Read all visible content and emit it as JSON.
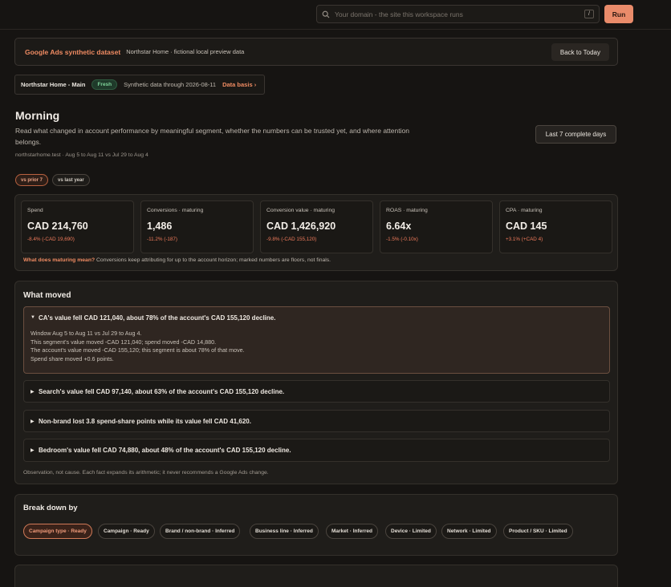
{
  "topbar": {
    "search_placeholder": "Your domain - the site this workspace runs",
    "shortcut": "/",
    "run_label": "Run"
  },
  "banner": {
    "title": "Google Ads synthetic dataset",
    "subtitle": "Northstar Home · fictional local preview data",
    "back_label": "Back to Today"
  },
  "account": {
    "name": "Northstar Home - Main",
    "badge": "Fresh",
    "through": "Synthetic data through 2026-08-11",
    "basis_link": "Data basis ›"
  },
  "heading": {
    "title": "Morning",
    "description": "Read what changed in account performance by meaningful segment, whether the numbers can be trusted yet, and where attention belongs.",
    "meta": "northstarhome.test · Aug 5 to Aug 11 vs Jul 29 to Aug 4",
    "range_label": "Last 7 complete days"
  },
  "comparisons": [
    {
      "label": "vs prior 7",
      "active": true
    },
    {
      "label": "vs last year",
      "active": false
    }
  ],
  "kpis": [
    {
      "label": "Spend",
      "value": "CAD 214,760",
      "delta": "-8.4% (-CAD 19,690)"
    },
    {
      "label": "Conversions · maturing",
      "value": "1,486",
      "delta": "-11.2% (-187)"
    },
    {
      "label": "Conversion value · maturing",
      "value": "CAD 1,426,920",
      "delta": "-9.8% (-CAD 155,120)"
    },
    {
      "label": "ROAS · maturing",
      "value": "6.64x",
      "delta": "-1.5% (-0.10x)"
    },
    {
      "label": "CPA · maturing",
      "value": "CAD 145",
      "delta": "+3.1% (+CAD 4)"
    }
  ],
  "maturing_note": {
    "question": "What does maturing mean?",
    "answer": "Conversions keep attributing for up to the account horizon; marked numbers are floors, not finals."
  },
  "what_moved": {
    "title": "What moved",
    "facts": [
      {
        "headline": "CA's value fell CAD 121,040, about 78% of the account's CAD 155,120 decline.",
        "open": true,
        "details": [
          "Window Aug 5 to Aug 11 vs Jul 29 to Aug 4.",
          "This segment's value moved -CAD 121,040; spend moved -CAD 14,880.",
          "The account's value moved -CAD 155,120; this segment is about 78% of that move.",
          "Spend share moved +0.6 points."
        ]
      },
      {
        "headline": "Search's value fell CAD 97,140, about 63% of the account's CAD 155,120 decline.",
        "open": false
      },
      {
        "headline": "Non-brand lost 3.8 spend-share points while its value fell CAD 41,620.",
        "open": false
      },
      {
        "headline": "Bedroom's value fell CAD 74,880, about 48% of the account's CAD 155,120 decline.",
        "open": false
      }
    ],
    "footnote": "Observation, not cause. Each fact expands its arithmetic; it never recommends a Google Ads change."
  },
  "break_down": {
    "title": "Break down by",
    "segments": [
      "Campaign type · Ready",
      "Campaign · Ready",
      "Brand / non-brand · Inferred",
      "Business line · Inferred",
      "Market · Inferred",
      "Device · Limited",
      "Network · Limited",
      "Product / SKU · Limited"
    ]
  },
  "icons": {
    "search": "search-icon",
    "expand": "triangle-right-icon",
    "collapse": "triangle-down-icon"
  },
  "colors": {
    "accent": "#e98b6a",
    "negative": "#ef7a5b",
    "fresh": "#7fd49a",
    "background": "#161412"
  }
}
